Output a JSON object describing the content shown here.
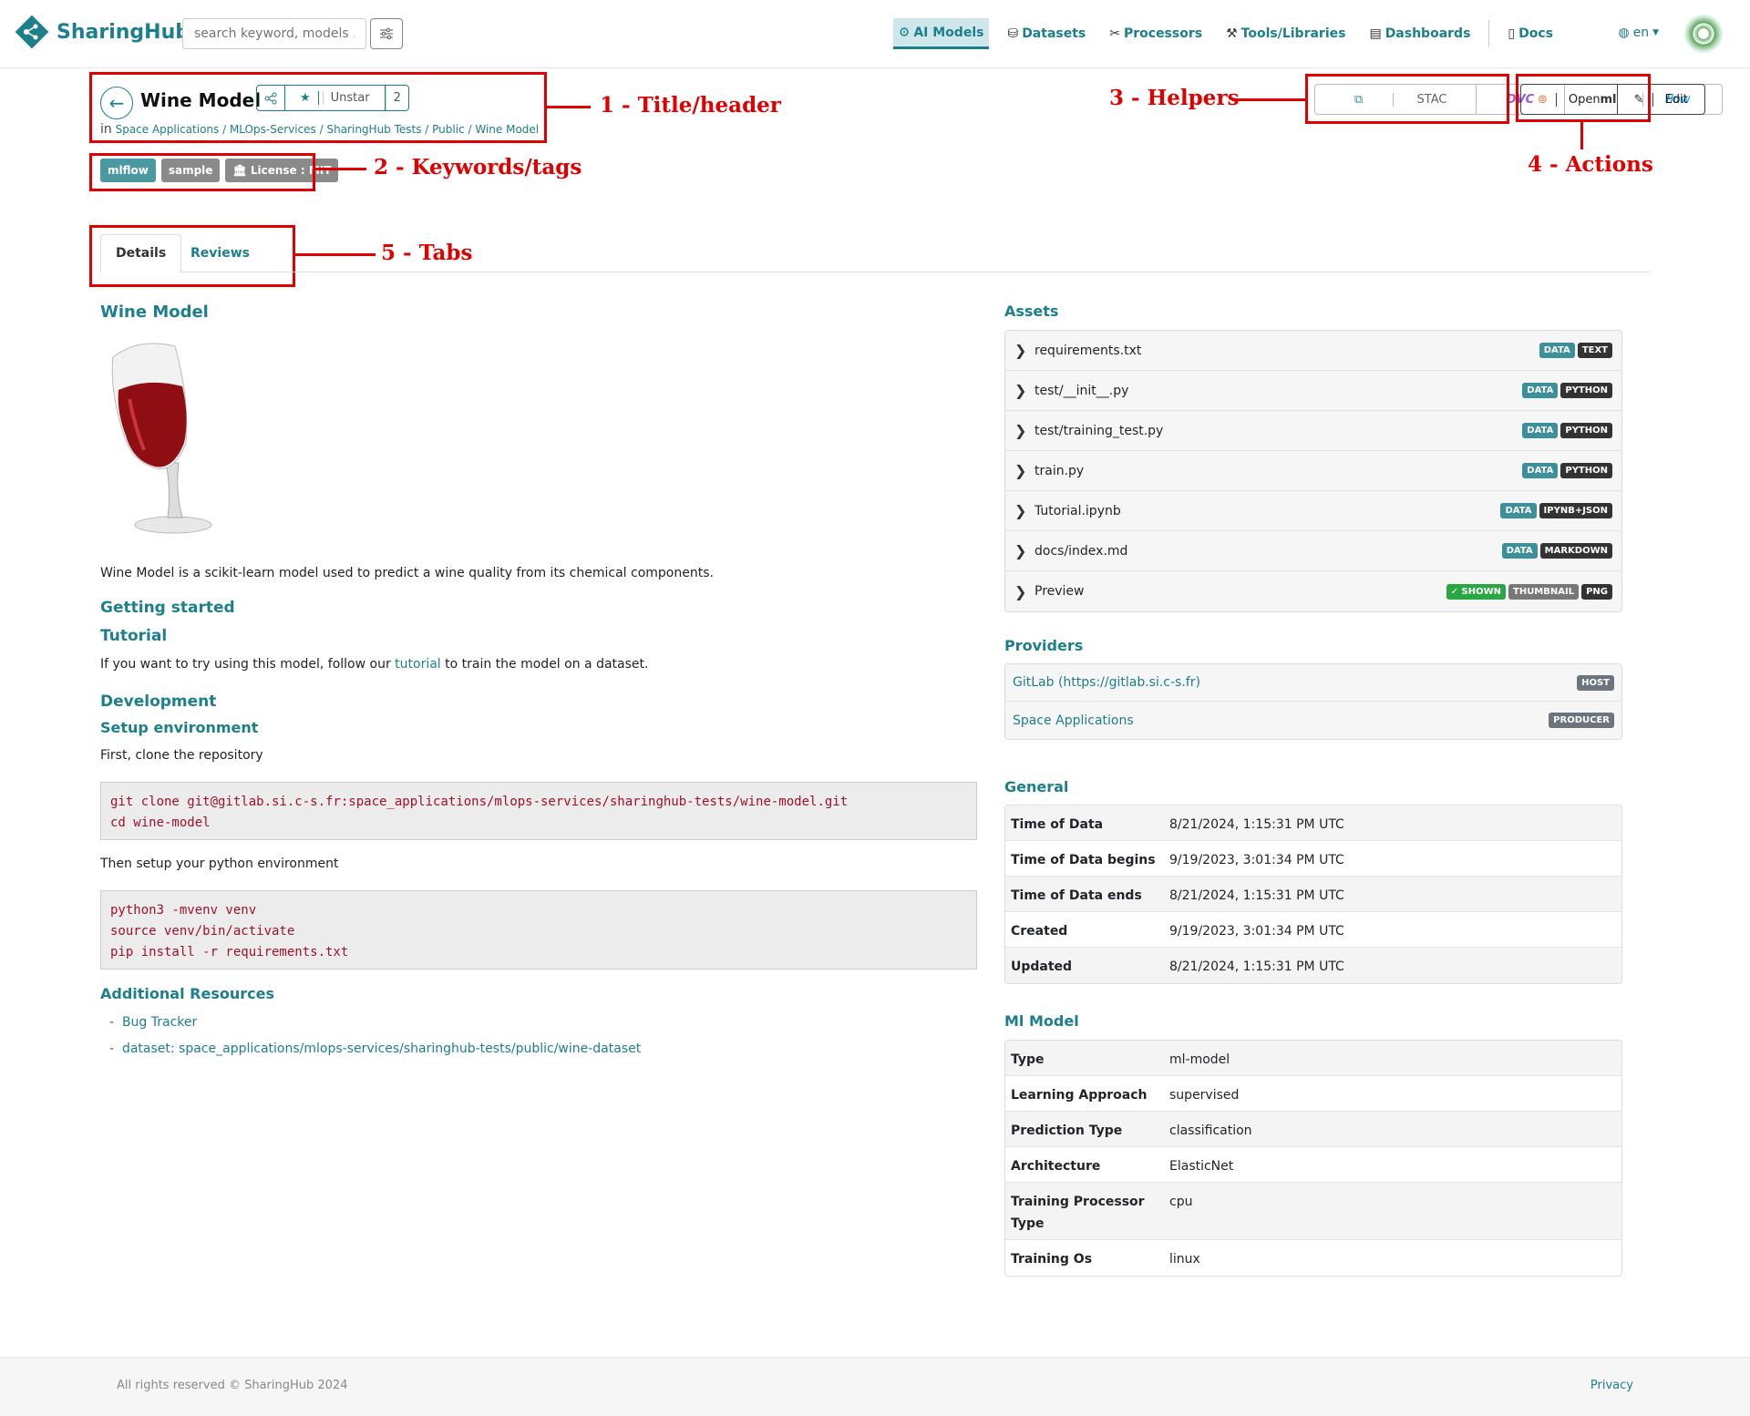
{
  "nav": {
    "brand": "SharingHub",
    "search_placeholder": "search keyword, models ...",
    "links": [
      "AI Models",
      "Datasets",
      "Processors",
      "Tools/Libraries",
      "Dashboards"
    ],
    "docs": "Docs",
    "lang": "en"
  },
  "header": {
    "title": "Wine Model",
    "unstar": "Unstar",
    "star_count": "2",
    "crumb_prefix": "in",
    "crumb": "Space Applications / MLOps-Services / SharingHub Tests / Public / Wine Model"
  },
  "tags": [
    {
      "label": "mlflow",
      "color": "#4a98a2"
    },
    {
      "label": "sample",
      "color": "#8a8a8a"
    },
    {
      "label": "License : MIT",
      "color": "#8a8a8a"
    }
  ],
  "helpers": {
    "stac": "STAC",
    "dvc": "DVC",
    "mlflow_ml": "ml",
    "mlflow_flow": "flow"
  },
  "actions": {
    "open": "Open",
    "edit": "Edit"
  },
  "annotations": {
    "a1": "1 - Title/header",
    "a2": "2 - Keywords/tags",
    "a3": "3 - Helpers",
    "a4": "4 - Actions",
    "a5": "5 - Tabs"
  },
  "tabs": {
    "details": "Details",
    "reviews": "Reviews"
  },
  "main": {
    "heading": "Wine Model",
    "description": "Wine Model is a scikit-learn model used to predict a wine quality from its chemical components.",
    "getting_started": "Getting started",
    "tutorial": "Tutorial",
    "tutorial_pre": "If you want to try using this model, follow our",
    "tutorial_link": "tutorial",
    "tutorial_post": "to train the model on a dataset.",
    "development": "Development",
    "setup_env": "Setup environment",
    "clone_text": "First, clone the repository",
    "code1": [
      "git clone git@gitlab.si.c-s.fr:space_applications/mlops-services/sharinghub-tests/wine-model.git",
      "cd wine-model"
    ],
    "then_setup": "Then setup your python environment",
    "code2": [
      "python3 -mvenv venv",
      "source venv/bin/activate",
      "pip install -r requirements.txt"
    ],
    "additional": "Additional Resources",
    "resources": [
      "Bug Tracker",
      "dataset: space_applications/mlops-services/sharinghub-tests/public/wine-dataset"
    ]
  },
  "assets": {
    "title": "Assets",
    "items": [
      {
        "name": "requirements.txt",
        "badges": [
          {
            "t": "DATA",
            "c": "#3d8f9a"
          },
          {
            "t": "TEXT",
            "c": "#333"
          }
        ]
      },
      {
        "name": "test/__init__.py",
        "badges": [
          {
            "t": "DATA",
            "c": "#3d8f9a"
          },
          {
            "t": "PYTHON",
            "c": "#333"
          }
        ]
      },
      {
        "name": "test/training_test.py",
        "badges": [
          {
            "t": "DATA",
            "c": "#3d8f9a"
          },
          {
            "t": "PYTHON",
            "c": "#333"
          }
        ]
      },
      {
        "name": "train.py",
        "badges": [
          {
            "t": "DATA",
            "c": "#3d8f9a"
          },
          {
            "t": "PYTHON",
            "c": "#333"
          }
        ]
      },
      {
        "name": "Tutorial.ipynb",
        "badges": [
          {
            "t": "DATA",
            "c": "#3d8f9a"
          },
          {
            "t": "IPYNB+JSON",
            "c": "#333"
          }
        ]
      },
      {
        "name": "docs/index.md",
        "badges": [
          {
            "t": "DATA",
            "c": "#3d8f9a"
          },
          {
            "t": "MARKDOWN",
            "c": "#333"
          }
        ]
      },
      {
        "name": "Preview",
        "badges": [
          {
            "t": "✓ SHOWN",
            "c": "#2aa745"
          },
          {
            "t": "THUMBNAIL",
            "c": "#777"
          },
          {
            "t": "PNG",
            "c": "#333"
          }
        ]
      }
    ]
  },
  "providers": {
    "title": "Providers",
    "items": [
      {
        "name": "GitLab (https://gitlab.si.c-s.fr)",
        "role": "HOST"
      },
      {
        "name": "Space Applications",
        "role": "PRODUCER"
      }
    ]
  },
  "general": {
    "title": "General",
    "rows": [
      [
        "Time of Data",
        "8/21/2024, 1:15:31 PM UTC"
      ],
      [
        "Time of Data begins",
        "9/19/2023, 3:01:34 PM UTC"
      ],
      [
        "Time of Data ends",
        "8/21/2024, 1:15:31 PM UTC"
      ],
      [
        "Created",
        "9/19/2023, 3:01:34 PM UTC"
      ],
      [
        "Updated",
        "8/21/2024, 1:15:31 PM UTC"
      ]
    ]
  },
  "mlmodel": {
    "title": "Ml Model",
    "rows": [
      [
        "Type",
        "ml-model"
      ],
      [
        "Learning Approach",
        "supervised"
      ],
      [
        "Prediction Type",
        "classification"
      ],
      [
        "Architecture",
        "ElasticNet"
      ],
      [
        "Training Processor Type",
        "cpu"
      ],
      [
        "Training Os",
        "linux"
      ]
    ]
  },
  "footer": {
    "copy": "All rights reserved © SharingHub 2024",
    "privacy": "Privacy"
  }
}
